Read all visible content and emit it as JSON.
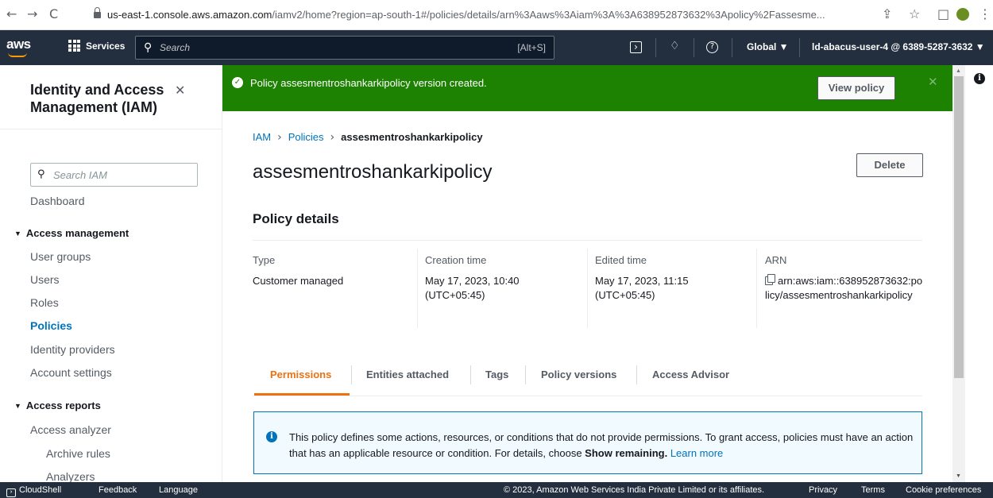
{
  "browser": {
    "back": "←",
    "forward": "→",
    "reload": "C",
    "url_host": "us-east-1.console.aws.amazon.com",
    "url_path": "/iamv2/home?region=ap-south-1#/policies/details/arn%3Aaws%3Aiam%3A%3A638952873632%3Apolicy%2Fassesme...",
    "share_icon": "⇪",
    "star_icon": "☆",
    "window_icon": "□",
    "menu_icon": "⋮"
  },
  "topnav": {
    "logo": "aws",
    "services_label": "Services",
    "search_placeholder": "Search",
    "search_shortcut": "[Alt+S]",
    "region": "Global ▼",
    "account": "ld-abacus-user-4 @ 6389-5287-3632 ▼"
  },
  "sidebar": {
    "title": "Identity and Access Management (IAM)",
    "search_placeholder": "Search IAM",
    "dashboard": "Dashboard",
    "access_management": {
      "label": "Access management",
      "items": [
        "User groups",
        "Users",
        "Roles",
        "Policies",
        "Identity providers",
        "Account settings"
      ]
    },
    "access_reports": {
      "label": "Access reports",
      "items": [
        "Access analyzer",
        "Archive rules",
        "Analyzers"
      ]
    }
  },
  "flash": {
    "message": "Policy assesmentroshankarkipolicy version created.",
    "button": "View policy"
  },
  "breadcrumb": {
    "items": [
      "IAM",
      "Policies",
      "assesmentroshankarkipolicy"
    ]
  },
  "page": {
    "title": "assesmentroshankarkipolicy",
    "delete_label": "Delete"
  },
  "policy_details": {
    "title": "Policy details",
    "type_label": "Type",
    "type_value": "Customer managed",
    "creation_label": "Creation time",
    "creation_value": "May 17, 2023, 10:40 (UTC+05:45)",
    "edited_label": "Edited time",
    "edited_value": "May 17, 2023, 11:15 (UTC+05:45)",
    "arn_label": "ARN",
    "arn_value": "arn:aws:iam::638952873632:policy/assesmentroshankarkipolicy"
  },
  "tabs": [
    "Permissions",
    "Entities attached",
    "Tags",
    "Policy versions",
    "Access Advisor"
  ],
  "info": {
    "text": "This policy defines some actions, resources, or conditions that do not provide permissions. To grant access, policies must have an action that has an applicable resource or condition. For details, choose ",
    "bold": "Show remaining.",
    "link": "Learn more"
  },
  "footer": {
    "cloudshell": "CloudShell",
    "feedback": "Feedback",
    "language": "Language",
    "copyright": "© 2023, Amazon Web Services India Private Limited or its affiliates.",
    "privacy": "Privacy",
    "terms": "Terms",
    "cookies": "Cookie preferences"
  },
  "colors": {
    "nav_bg": "#232f3e",
    "success": "#1d8102",
    "link": "#0073bb",
    "active_tab": "#ec7211"
  }
}
